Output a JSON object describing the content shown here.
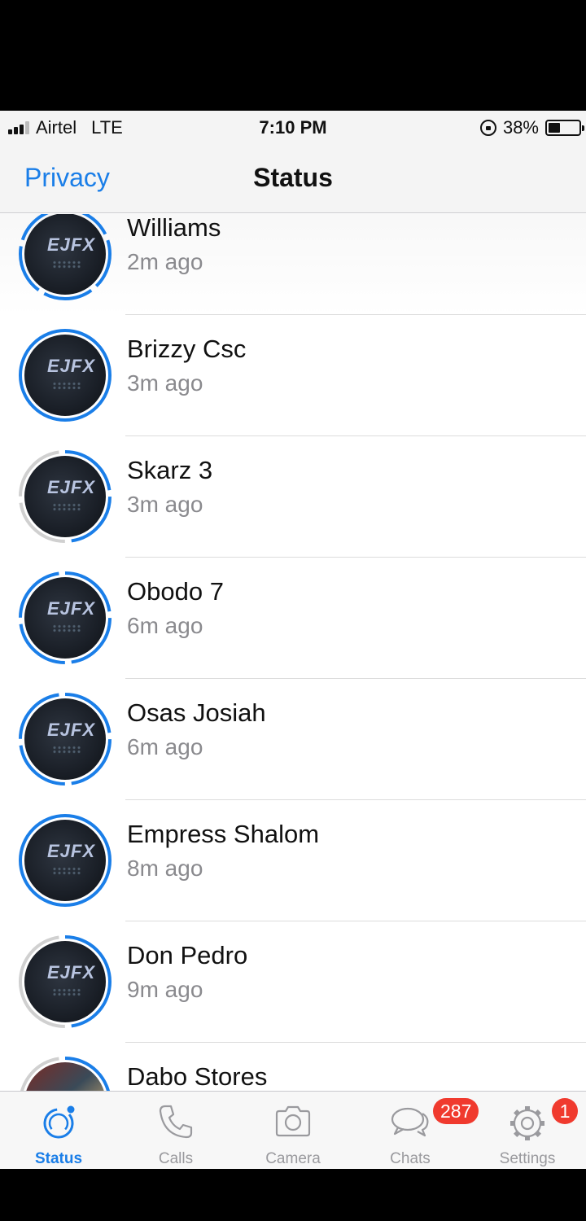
{
  "status_bar": {
    "carrier": "Airtel",
    "network": "LTE",
    "time": "7:10 PM",
    "battery": "38%",
    "battery_level": 0.38
  },
  "nav": {
    "back_label": "Privacy",
    "title": "Status"
  },
  "contacts": [
    {
      "name": "Williams",
      "time": "2m ago"
    },
    {
      "name": "Brizzy Csc",
      "time": "3m ago"
    },
    {
      "name": "Skarz 3",
      "time": "3m ago"
    },
    {
      "name": "Obodo 7",
      "time": "6m ago"
    },
    {
      "name": "Osas Josiah",
      "time": "6m ago"
    },
    {
      "name": "Empress Shalom",
      "time": "8m ago"
    },
    {
      "name": "Don Pedro",
      "time": "9m ago"
    },
    {
      "name": "Dabo Stores",
      "time": ""
    }
  ],
  "avatar_logo": "EJFX",
  "tabs": [
    {
      "label": "Status",
      "icon": "status-icon",
      "badge": ""
    },
    {
      "label": "Calls",
      "icon": "phone-icon",
      "badge": ""
    },
    {
      "label": "Camera",
      "icon": "camera-icon",
      "badge": ""
    },
    {
      "label": "Chats",
      "icon": "chat-bubbles-icon",
      "badge": "287"
    },
    {
      "label": "Settings",
      "icon": "gear-icon",
      "badge": "1"
    }
  ],
  "colors": {
    "accent": "#1a7ee8",
    "badge": "#f03a2e",
    "ring_seen": "#d0d0d0"
  }
}
